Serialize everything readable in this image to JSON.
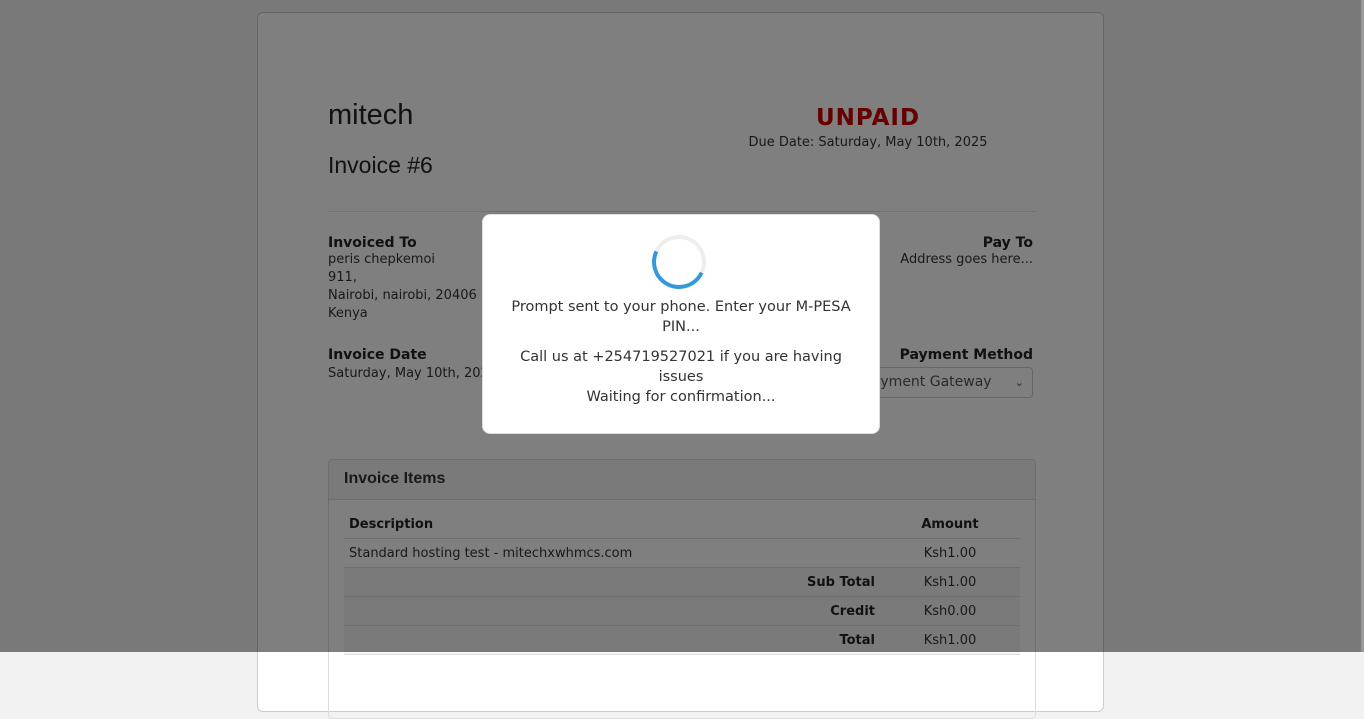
{
  "invoice": {
    "company": "mitech",
    "number": "Invoice #6",
    "status": "UNPAID",
    "status_color": "#cc0000",
    "due_date": "Due Date: Saturday, May 10th, 2025",
    "invoiced_to": {
      "label": "Invoiced To",
      "name": "peris chepkemoi",
      "line1": "911,",
      "line2": "Nairobi, nairobi, 20406",
      "country": "Kenya"
    },
    "pay_to": {
      "label": "Pay To",
      "address": "Address goes here..."
    },
    "invoice_date": {
      "label": "Invoice Date",
      "value": "Saturday, May 10th, 2025"
    },
    "payment_method": {
      "label": "Payment Method",
      "selected": "Payment Gateway"
    },
    "items": {
      "title": "Invoice Items",
      "headers": {
        "description": "Description",
        "amount": "Amount"
      },
      "rows": [
        {
          "description": "Standard hosting test - mitechxwhmcs.com",
          "amount": "Ksh1.00"
        }
      ],
      "sub_total": {
        "label": "Sub Total",
        "amount": "Ksh1.00"
      },
      "credit": {
        "label": "Credit",
        "amount": "Ksh0.00"
      },
      "total": {
        "label": "Total",
        "amount": "Ksh1.00"
      }
    }
  },
  "modal": {
    "prompt": "Prompt sent to your phone. Enter your M-PESA PIN...",
    "help": "Call us at +254719527021 if you are having issues",
    "waiting": "Waiting for confirmation...",
    "spinner_color": "#3498db"
  }
}
